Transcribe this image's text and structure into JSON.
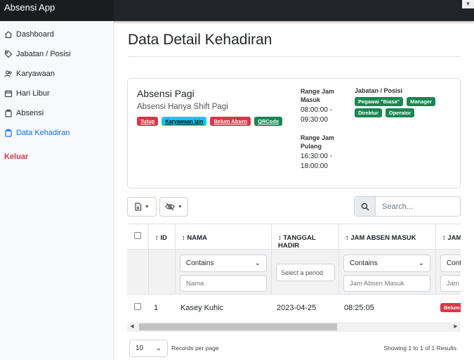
{
  "app": {
    "title": "Absensi App"
  },
  "sidebar": {
    "items": [
      {
        "label": "Dashboard",
        "icon": "home-icon"
      },
      {
        "label": "Jabatan / Posisi",
        "icon": "tag-icon"
      },
      {
        "label": "Karyawaan",
        "icon": "people-icon"
      },
      {
        "label": "Hari Libur",
        "icon": "calendar-icon"
      },
      {
        "label": "Absensi",
        "icon": "clipboard-icon"
      },
      {
        "label": "Data Kehadiran",
        "icon": "clipboard-icon",
        "active": true
      }
    ],
    "logout_label": "Keluar"
  },
  "page": {
    "title": "Data Detail Kehadiran"
  },
  "card": {
    "title": "Absensi Pagi",
    "subtitle": "Absensi Hanya Shift Pagi",
    "badges": [
      "Tutup",
      "Karyawaan Izin",
      "Belum Absen",
      "QRCode"
    ],
    "range_masuk_label": "Range Jam Masuk",
    "range_masuk_value": "08:00:00 - 09:30:00",
    "range_pulang_label": "Range Jam Pulang",
    "range_pulang_value": "16:30:00 - 18:00:00",
    "jabatan_label": "Jabatan / Posisi",
    "jabatan_badges": [
      "Pegawai \"Biasa\"",
      "Manager",
      "Direktur",
      "Operator"
    ]
  },
  "toolbar": {
    "search_placeholder": "Search..."
  },
  "table": {
    "headers": [
      "ID",
      "NAMA",
      "TANGGAL HADIR",
      "JAM ABSEN MASUK",
      "JAM"
    ],
    "filters": {
      "nama_select": "Contains",
      "nama_placeholder": "Nama",
      "tanggal_placeholder": "Select a period",
      "jam_select": "Contains",
      "jam_placeholder": "Jam Absen Masuk",
      "jam2_select": "Cont",
      "jam2_placeholder": "Jam"
    },
    "rows": [
      {
        "id": "1",
        "nama": "Kasey Kuhic",
        "tanggal": "2023-04-25",
        "jam_masuk": "08:25:05",
        "status": "Belum"
      }
    ]
  },
  "footer": {
    "per_page": "10",
    "per_page_label": "Records per page",
    "showing": "Showing 1 to 1 of 1 Results"
  },
  "colors": {
    "danger": "#dc3545",
    "info": "#0dcaf0",
    "success": "#198754",
    "primary": "#0d6efd"
  }
}
